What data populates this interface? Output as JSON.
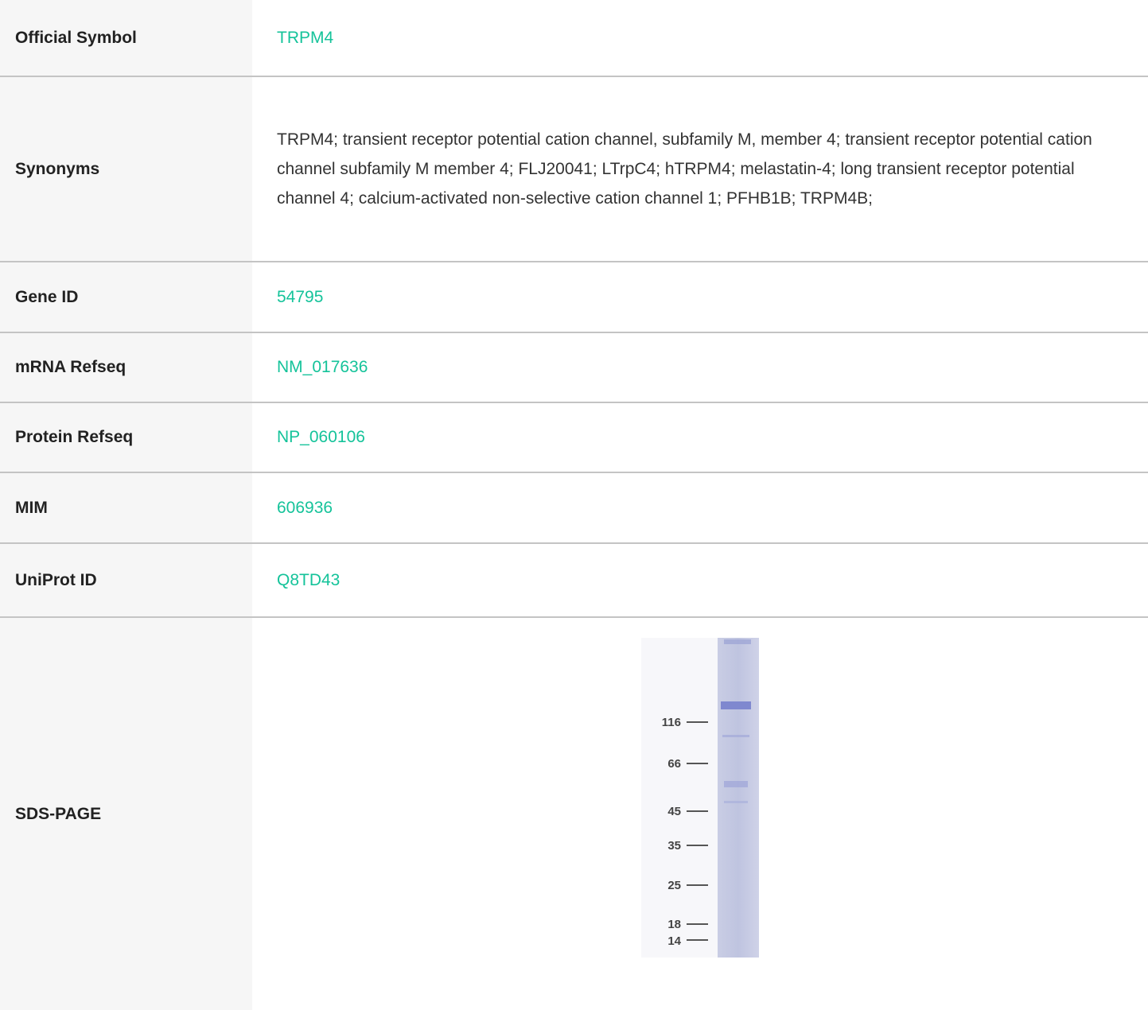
{
  "rows": [
    {
      "label": "Official Symbol",
      "value": "TRPM4"
    },
    {
      "label": "Synonyms",
      "value": "TRPM4; transient receptor potential cation channel, subfamily M, member 4; transient receptor potential cation channel subfamily M member 4; FLJ20041; LTrpC4; hTRPM4; melastatin-4; long transient receptor potential channel 4; calcium-activated non-selective cation channel 1; PFHB1B; TRPM4B;"
    },
    {
      "label": "Gene ID",
      "value": "54795"
    },
    {
      "label": "mRNA Refseq",
      "value": "NM_017636"
    },
    {
      "label": "Protein Refseq",
      "value": "NP_060106"
    },
    {
      "label": "MIM",
      "value": "606936"
    },
    {
      "label": "UniProt ID",
      "value": "Q8TD43"
    },
    {
      "label": "SDS-PAGE"
    }
  ],
  "gel": {
    "markers": [
      "116",
      "66",
      "45",
      "35",
      "25",
      "18",
      "14"
    ]
  },
  "colors": {
    "link": "#15c39a",
    "label_bg": "#f6f6f6",
    "divider": "#c4c4c4"
  }
}
